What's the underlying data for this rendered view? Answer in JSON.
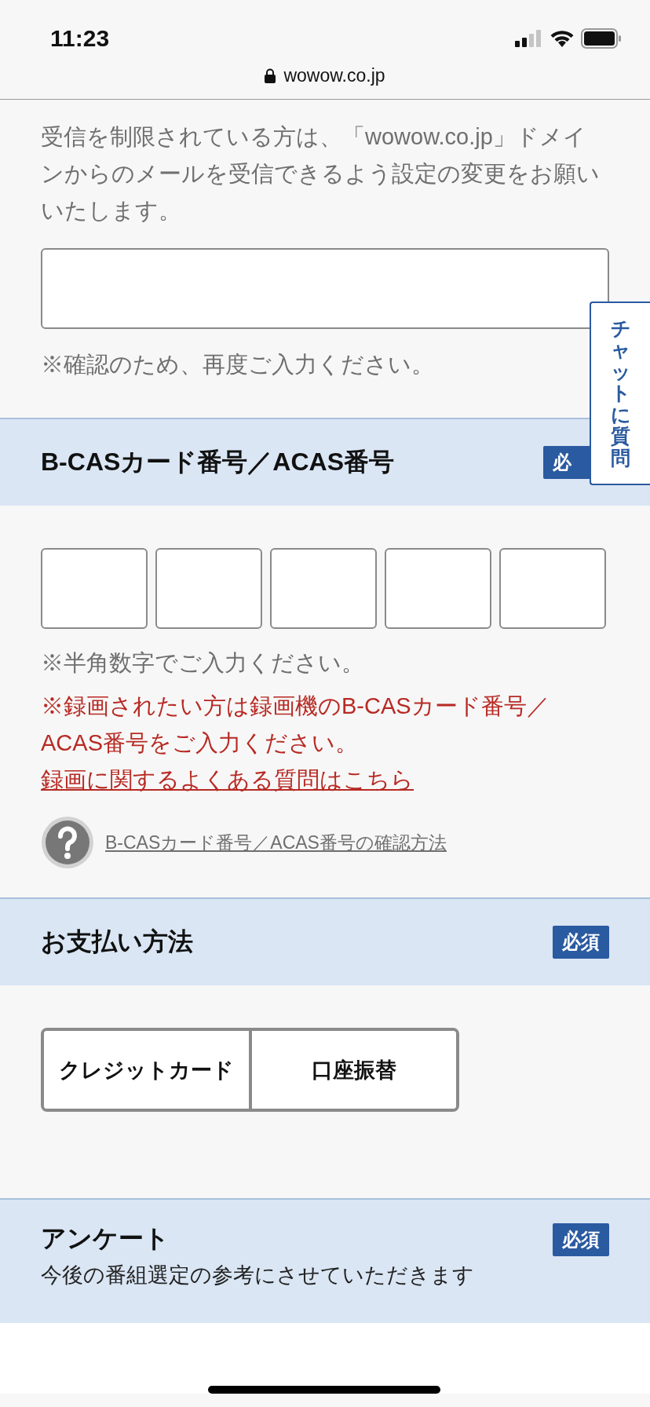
{
  "status_bar": {
    "time": "11:23"
  },
  "address_bar": {
    "url": "wowow.co.jp"
  },
  "email_confirm": {
    "notice": "受信を制限されている方は、「wowow.co.jp」ドメインからのメールを受信できるよう設定の変更をお願いいたします。",
    "note": "※確認のため、再度ご入力ください。"
  },
  "chat_tab": {
    "label": "チャットに質問"
  },
  "bcas_section": {
    "title": "B-CASカード番号／ACAS番号",
    "badge": "必",
    "inputs": [
      {
        "kind": "text"
      },
      {
        "kind": "text"
      },
      {
        "kind": "text"
      },
      {
        "kind": "text"
      },
      {
        "kind": "text"
      }
    ],
    "note": "※半角数字でご入力ください。",
    "warning": {
      "text": "※録画されたい方は録画機のB-CASカード番号／ACAS番号をご入力ください。",
      "link": "録画に関するよくある質問はこちら"
    },
    "help_link": "B-CASカード番号／ACAS番号の確認方法"
  },
  "payment_section": {
    "title": "お支払い方法",
    "badge": "必須",
    "options": [
      {
        "label": "クレジットカード",
        "selected": false
      },
      {
        "label": "口座振替",
        "selected": false
      }
    ]
  },
  "survey_section": {
    "title": "アンケート",
    "subtitle": "今後の番組選定の参考にさせていただきます",
    "badge": "必須"
  }
}
